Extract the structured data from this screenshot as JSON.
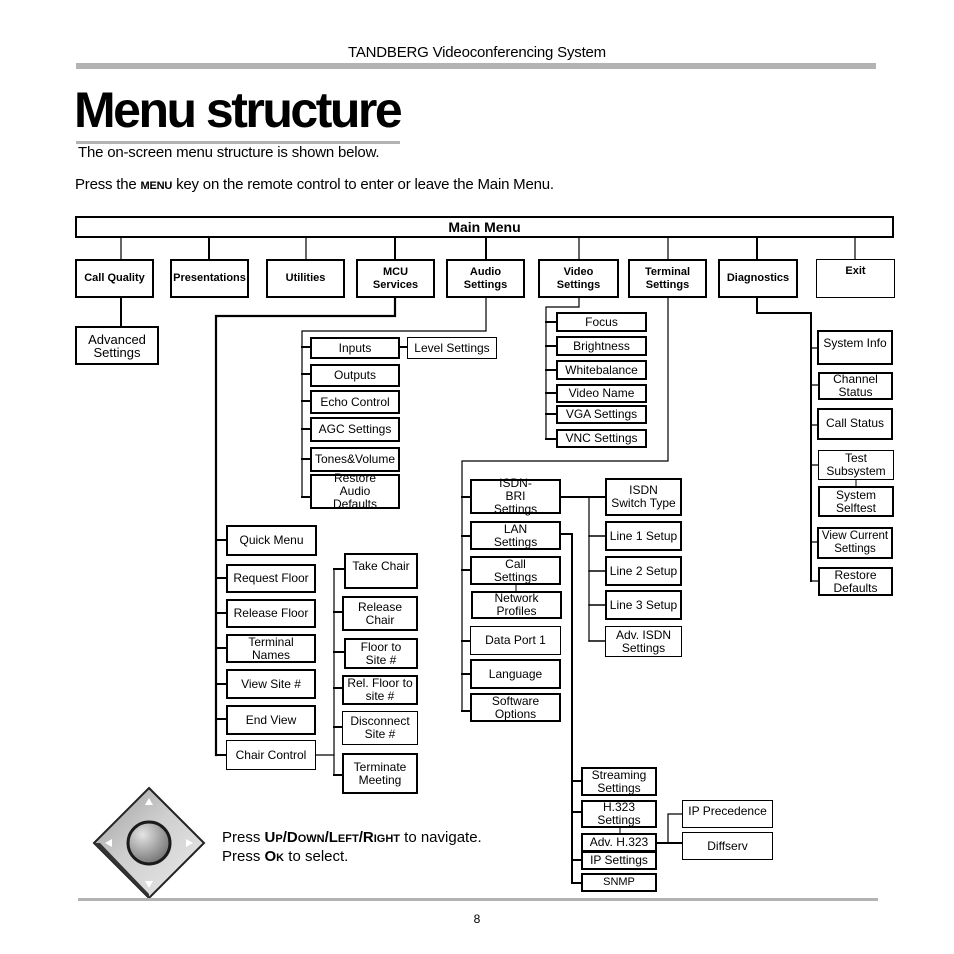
{
  "header": {
    "doc_title": "TANDBERG Videoconferencing System"
  },
  "page": {
    "title": "Menu structure",
    "intro": "The on-screen menu structure is shown below.",
    "instruction": {
      "pre": "Press the ",
      "key": "Menu",
      "post": " key on the remote control to enter or leave the Main Menu."
    },
    "page_number": "8"
  },
  "menu": {
    "root": "Main Menu",
    "top": [
      {
        "label": "Call Quality"
      },
      {
        "label": "Presentations"
      },
      {
        "label": "Utilities"
      },
      {
        "label": "MCU Services"
      },
      {
        "label": "Audio Settings"
      },
      {
        "label": "Video Settings"
      },
      {
        "label": "Terminal Settings"
      },
      {
        "label": "Diagnostics"
      },
      {
        "label": "Exit"
      }
    ],
    "call_quality": [
      "Advanced Settings"
    ],
    "mcu_services": [
      "Quick Menu",
      "Request Floor",
      "Release Floor",
      "Terminal Names",
      "View Site #",
      "End View",
      "Chair Control"
    ],
    "chair_control": [
      "Take Chair",
      "Release Chair",
      "Floor to Site #",
      "Rel. Floor to site #",
      "Disconnect Site #",
      "Terminate Meeting"
    ],
    "audio_settings": [
      "Inputs",
      "Outputs",
      "Echo Control",
      "AGC Settings",
      "Tones&Volume",
      "Restore Audio Defaults"
    ],
    "inputs": [
      "Level Settings"
    ],
    "video_settings": [
      "Focus",
      "Brightness",
      "Whitebalance",
      "Video Name",
      "VGA Settings",
      "VNC Settings"
    ],
    "terminal_settings": [
      "ISDN-BRI Settings",
      "LAN Settings",
      "Call Settings",
      "Network Profiles",
      "Data Port 1",
      "Language",
      "Software Options"
    ],
    "isdn_bri": [
      "ISDN Switch Type",
      "Line 1 Setup",
      "Line 2 Setup",
      "Line 3 Setup",
      "Adv. ISDN Settings"
    ],
    "lan_settings": [
      "Streaming Settings",
      "H.323 Settings",
      "Adv. H.323",
      "IP Settings",
      "SNMP"
    ],
    "adv_h323": [
      "IP Precedence",
      "Diffserv"
    ],
    "diagnostics": [
      "System Info",
      "Channel Status",
      "Call Status",
      "Test Subsystem",
      "System Selftest",
      "View Current Settings",
      "Restore Defaults"
    ]
  },
  "navigation_help": {
    "line1_pre": "Press ",
    "keys": [
      "Up",
      "Down",
      "Left",
      "Right"
    ],
    "line1_post": " to navigate.",
    "line2_pre": "Press ",
    "ok_key": "Ok",
    "line2_post": " to select."
  }
}
